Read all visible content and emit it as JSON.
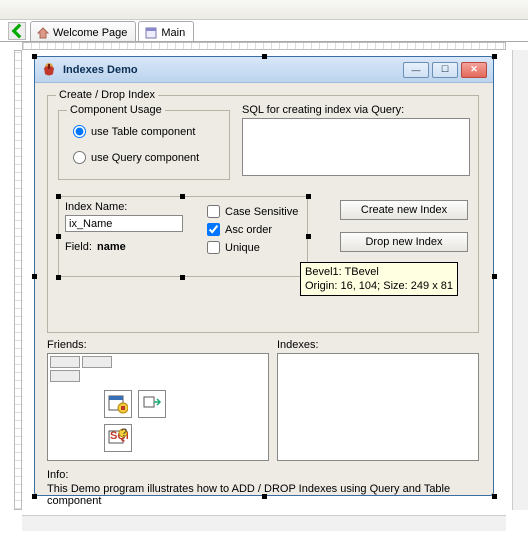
{
  "tabs": {
    "welcome": "Welcome Page",
    "main": "Main"
  },
  "window": {
    "title": "Indexes Demo"
  },
  "group_main": "Create / Drop Index",
  "component_usage": {
    "legend": "Component Usage",
    "opt_table": "use Table component",
    "opt_query": "use Query component"
  },
  "sql_label": "SQL for creating index via Query:",
  "index_name_label": "Index Name:",
  "index_name_value": "ix_Name",
  "field_label": "Field:",
  "field_value": "name",
  "checks": {
    "case": "Case Sensitive",
    "asc": "Asc order",
    "unique": "Unique"
  },
  "buttons": {
    "create": "Create new Index",
    "drop": "Drop new Index"
  },
  "friends_label": "Friends:",
  "indexes_label": "Indexes:",
  "info_label": "Info:",
  "info_text": "This Demo program illustrates how to ADD / DROP Indexes using Query and Table component",
  "tooltip": "Bevel1: TBevel\nOrigin: 16, 104; Size: 249 x 81"
}
